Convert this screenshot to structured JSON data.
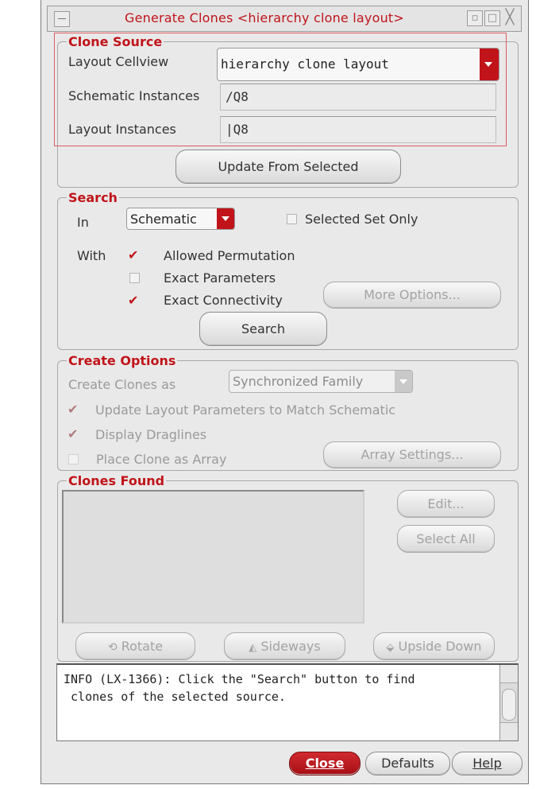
{
  "window": {
    "title": "Generate Clones <hierarchy clone layout>",
    "icons": [
      "minimize-icon",
      "maximize-icon",
      "close-icon"
    ]
  },
  "clone_source": {
    "title": "Clone Source",
    "layout_cellview_label": "Layout Cellview",
    "layout_cellview_value": "hierarchy clone layout",
    "schematic_instances_label": "Schematic Instances",
    "schematic_instances_value": "/Q8",
    "layout_instances_label": "Layout Instances",
    "layout_instances_value": "|Q8",
    "update_button": "Update From Selected"
  },
  "search": {
    "title": "Search",
    "in_label": "In",
    "in_value": "Schematic",
    "selected_set_only": "Selected Set Only",
    "with_label": "With",
    "allowed_permutation": "Allowed Permutation",
    "exact_parameters": "Exact Parameters",
    "exact_connectivity": "Exact Connectivity",
    "more_options": "More Options...",
    "search_button": "Search"
  },
  "create_options": {
    "title": "Create Options",
    "create_clones_as_label": "Create Clones as",
    "create_clones_as_value": "Synchronized Family",
    "update_layout_params": "Update Layout Parameters to Match Schematic",
    "display_draglines": "Display Draglines",
    "place_clone_as_array": "Place Clone as Array",
    "array_settings": "Array Settings..."
  },
  "clones_found": {
    "title": "Clones Found",
    "edit": "Edit...",
    "select_all": "Select All",
    "rotate": "Rotate",
    "sideways": "Sideways",
    "upside_down": "Upside Down"
  },
  "message": "INFO (LX-1366): Click the \"Search\" button to find\n clones of the selected source.",
  "footer": {
    "close": "Close",
    "defaults": "Defaults",
    "help": "Help"
  },
  "colors": {
    "accent": "#c0141a",
    "background": "#e9e9e9"
  }
}
